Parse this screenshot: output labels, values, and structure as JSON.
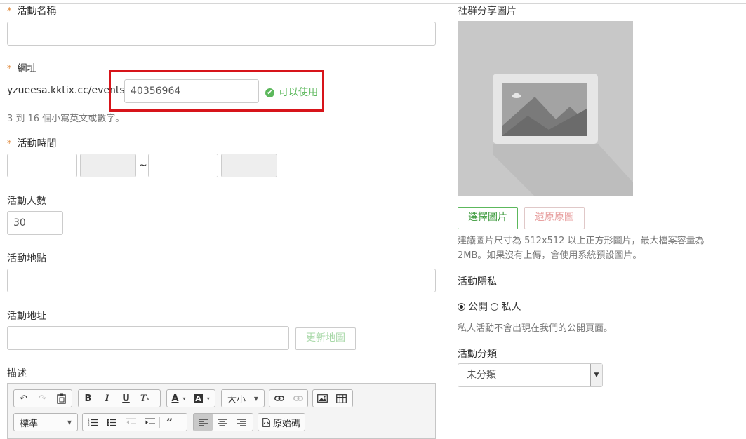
{
  "event_name": {
    "label": "活動名稱",
    "value": ""
  },
  "url": {
    "label": "網址",
    "prefix": "yzueesa.kktix.cc/events/",
    "value": "40356964",
    "status": "可以使用",
    "help": "3 到 16 個小寫英文或數字。"
  },
  "event_time": {
    "label": "活動時間",
    "separator": "~"
  },
  "attendees": {
    "label": "活動人數",
    "value": "30"
  },
  "venue": {
    "label": "活動地點",
    "value": ""
  },
  "address": {
    "label": "活動地址",
    "value": "",
    "update_map_label": "更新地圖"
  },
  "description": {
    "label": "描述",
    "toolbar": {
      "size_label": "大小",
      "format_label": "標準",
      "source_label": "原始碼"
    }
  },
  "share_image": {
    "label": "社群分享圖片",
    "choose_label": "選擇圖片",
    "restore_label": "還原原圖",
    "help_line1": "建議圖片尺寸為 512x512 以上正方形圖片，最大檔案容量為",
    "help_line2": "2MB。如果沒有上傳，會使用系統預設圖片。"
  },
  "privacy": {
    "label": "活動隱私",
    "public_label": "公開",
    "private_label": "私人",
    "selected": "公開",
    "help": "私人活動不會出現在我們的公開頁面。"
  },
  "category": {
    "label": "活動分類",
    "selected": "未分類"
  },
  "colors": {
    "required": "#e08a3c",
    "success": "#5cb85c",
    "highlight": "#d7141a"
  }
}
